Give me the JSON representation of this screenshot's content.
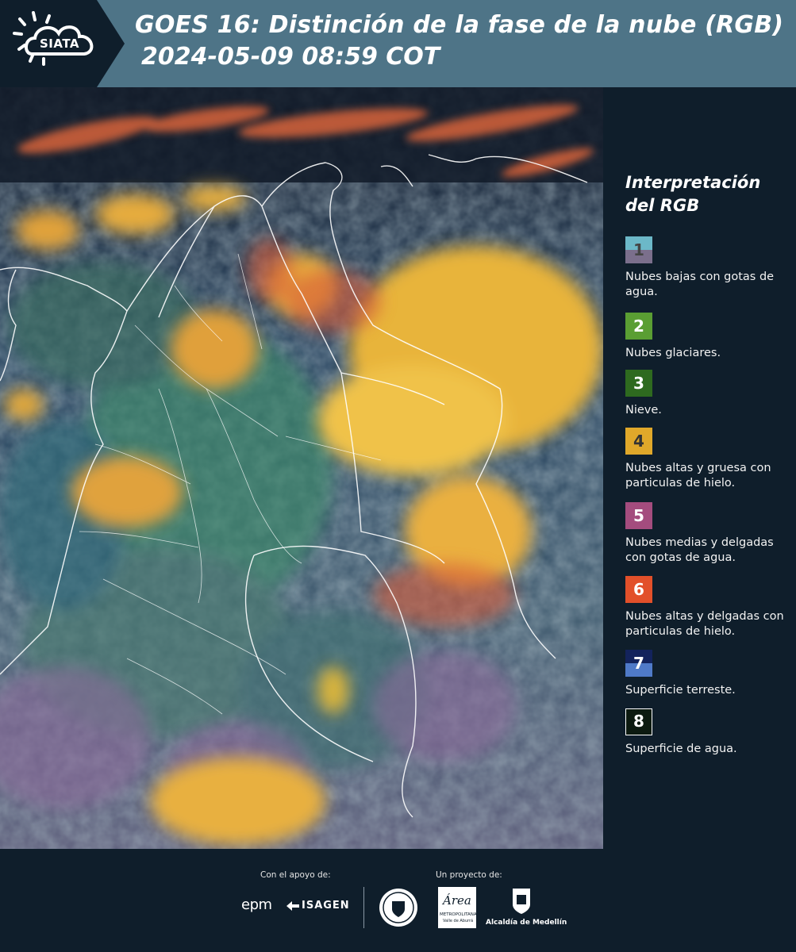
{
  "header": {
    "brand": "SIATA",
    "title_line1": "GOES 16: Distinción de la fase de la nube (RGB)",
    "title_line2": "2024-05-09 08:59 COT"
  },
  "map": {
    "description_icon": "satellite-rgb-cloud-phase-image"
  },
  "legend": {
    "title": "Interpretación del RGB",
    "items": [
      {
        "num": "1",
        "label": "Nubes bajas con gotas de agua.",
        "color_top": "#6cb8c8",
        "color_bottom": "#7b6f8c",
        "num_color": "#444444"
      },
      {
        "num": "2",
        "label": "Nubes glaciares.",
        "color_top": "#5a9e33",
        "color_bottom": "#5a9e33",
        "num_color": "#ffffff"
      },
      {
        "num": "3",
        "label": "Nieve.",
        "color_top": "#2e6a1f",
        "color_bottom": "#2e6a1f",
        "num_color": "#ffffff"
      },
      {
        "num": "4",
        "label": "Nubes altas y gruesa con particulas de hielo.",
        "color_top": "#e0a82a",
        "color_bottom": "#e0a82a",
        "num_color": "#333333"
      },
      {
        "num": "5",
        "label": "Nubes medias y delgadas con gotas de agua.",
        "color_top": "#a44c7e",
        "color_bottom": "#a44c7e",
        "num_color": "#ffffff"
      },
      {
        "num": "6",
        "label": "Nubes altas y delgadas con particulas de hielo.",
        "color_top": "#e2502a",
        "color_bottom": "#e2502a",
        "num_color": "#ffffff"
      },
      {
        "num": "7",
        "label": "Superficie terreste.",
        "color_top": "#13235c",
        "color_bottom": "#4f7ac8",
        "num_color": "#ffffff"
      },
      {
        "num": "8",
        "label": "Superficie de agua.",
        "color_top": "#0c1a10",
        "color_bottom": "#0c1a10",
        "num_color": "#ffffff"
      }
    ]
  },
  "footer": {
    "support_caption": "Con el apoyo de:",
    "project_caption": "Un proyecto de:",
    "sponsor1": "epm",
    "sponsor2": "ISAGEN",
    "partner1_text": "Área",
    "partner1_sub1": "METROPOLITANA",
    "partner1_sub2": "Valle de Aburrá",
    "partner2": "Alcaldía de Medellín"
  }
}
